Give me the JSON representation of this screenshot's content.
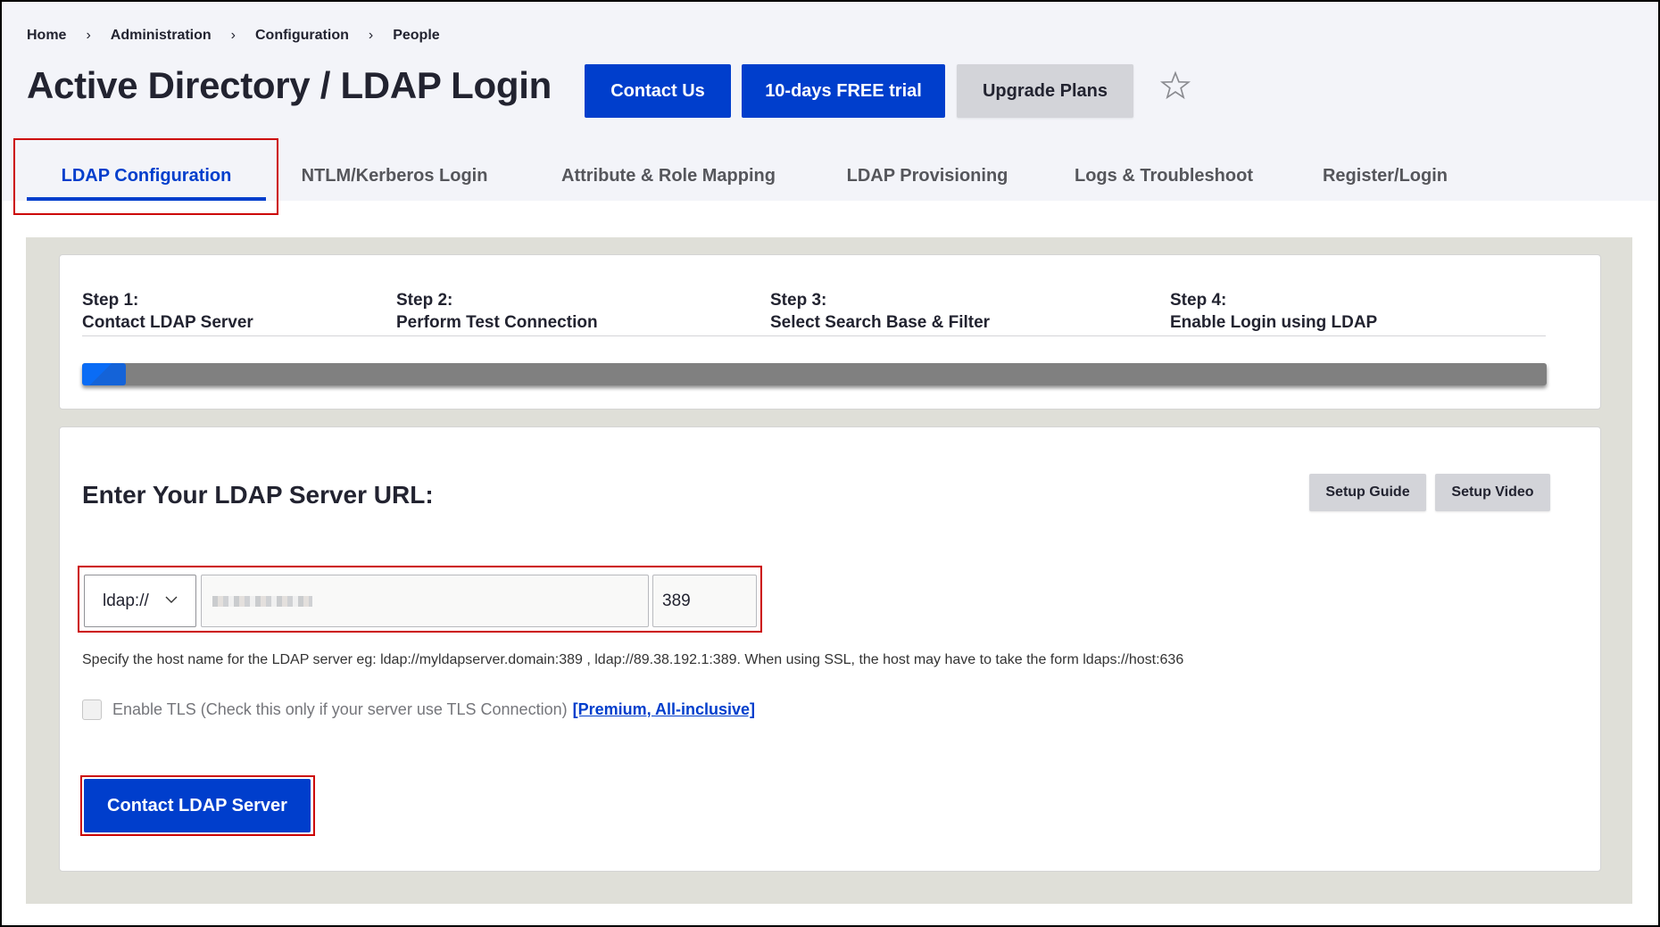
{
  "breadcrumb": [
    "Home",
    "Administration",
    "Configuration",
    "People"
  ],
  "breadcrumb_separator": "›",
  "page_title": "Active Directory / LDAP Login",
  "header_buttons": {
    "contact_us": "Contact Us",
    "free_trial": "10-days FREE trial",
    "upgrade_plans": "Upgrade Plans",
    "favorite_icon": "star-outline-icon"
  },
  "tabs": [
    {
      "label": "LDAP Configuration",
      "active": true
    },
    {
      "label": "NTLM/Kerberos Login",
      "active": false
    },
    {
      "label": "Attribute & Role Mapping",
      "active": false
    },
    {
      "label": "LDAP Provisioning",
      "active": false
    },
    {
      "label": "Logs & Troubleshoot",
      "active": false
    },
    {
      "label": "Register/Login",
      "active": false
    }
  ],
  "steps": [
    {
      "number": "Step 1:",
      "title": "Contact LDAP Server"
    },
    {
      "number": "Step 2:",
      "title": "Perform Test Connection"
    },
    {
      "number": "Step 3:",
      "title": "Select Search Base & Filter"
    },
    {
      "number": "Step 4:",
      "title": "Enable Login using LDAP"
    }
  ],
  "progress": {
    "percent": 3
  },
  "form": {
    "title": "Enter Your LDAP Server URL:",
    "setup_guide": "Setup Guide",
    "setup_video": "Setup Video",
    "protocol_selected": "ldap://",
    "host_value": "",
    "port_value": "389",
    "hint": "Specify the host name for the LDAP server eg: ldap://myldapserver.domain:389 , ldap://89.38.192.1:389. When using SSL, the host may have to take the form ldaps://host:636",
    "tls_label": "Enable TLS (Check this only if your server use TLS Connection)",
    "tls_checked": false,
    "tls_link": "[Premium, All-inclusive]",
    "submit": "Contact LDAP Server"
  },
  "colors": {
    "primary": "#003ecc",
    "annotation": "#cc0000",
    "header_bg": "#f3f4f9",
    "panel_bg": "#dfdfd8"
  }
}
